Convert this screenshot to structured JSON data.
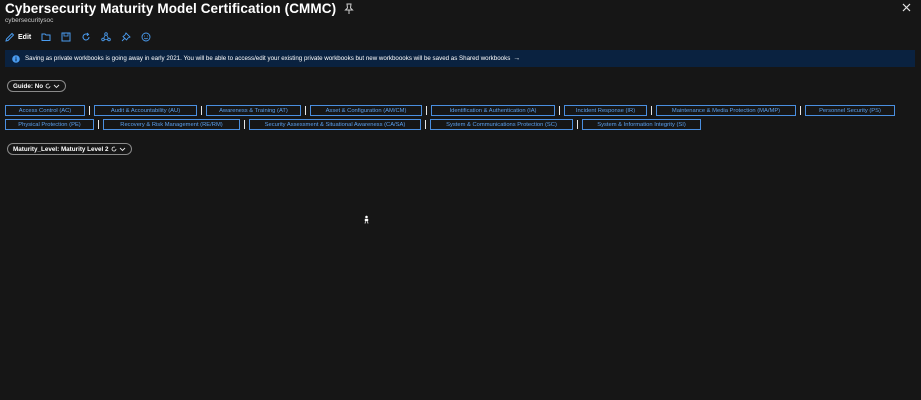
{
  "header": {
    "title": "Cybersecurity Maturity Model Certification (CMMC)",
    "subtitle": "cybersecuritysoc"
  },
  "toolbar": {
    "edit_label": "Edit",
    "icons": [
      "edit-icon",
      "open-icon",
      "save-icon",
      "refresh-icon",
      "share-icon",
      "pin-icon",
      "feedback-icon"
    ]
  },
  "banner": {
    "text": "Saving as private workbooks is going away in early 2021. You will be able to access/edit your existing private workbooks but new workboooks will be saved as Shared workbooks",
    "arrow": "→"
  },
  "params": {
    "guide_label": "Guide: No",
    "maturity_label": "Maturity_Level: Maturity Level 2"
  },
  "links": {
    "row1": [
      "Access Control (AC)",
      "Audit & Accountability (AU)",
      "Awareness & Training (AT)",
      "Asset & Configuration (AM/CM)",
      "Identification & Authentication (IA)",
      "Incident Response (IR)",
      "Maintenance & Media Protection (MA/MP)",
      "Personnel Security (PS)"
    ],
    "row2": [
      "Physical Protection (PE)",
      "Recovery & Risk Management (RE/RM)",
      "Security Assessment & Situational Awareness (CA/SA)",
      "System & Communications Protection (SC)",
      "System & Information Integrity (SI)"
    ]
  },
  "colors": {
    "background": "#161616",
    "banner": "#0a2240",
    "link": "#5aa0f0"
  }
}
